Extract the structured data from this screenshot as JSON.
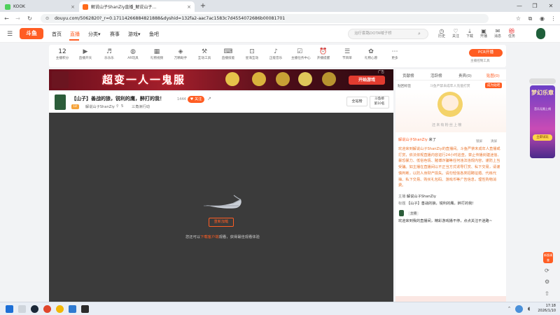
{
  "browser": {
    "tabs": [
      {
        "label": "KOOK",
        "close": "×"
      },
      {
        "label": "解说山子ShanZiy直播_解说山子…",
        "close": "×"
      }
    ],
    "new_tab": "+",
    "window_controls": [
      "—",
      "❐",
      "✕"
    ],
    "url": "douyu.com/5062820?_r=0.17114266884821888&dyshid=132fa2-aac7ac1583c7d4554072686b00081701"
  },
  "site": {
    "logo_text": "斗鱼",
    "nav": [
      "首页",
      "直播",
      "分类",
      "游戏",
      "赛事",
      "游戏",
      "鱼吧"
    ],
    "nav_final": [
      "首页",
      "直播",
      "分类▾",
      "赛事",
      "游戏▾",
      "鱼吧"
    ],
    "search_placeholder": "治疗套路DOTA喊子桥",
    "header_icons": [
      "历史",
      "关注",
      "下载",
      "开播",
      "消息",
      "任务"
    ]
  },
  "toolbar": {
    "score_value": "12",
    "score_label": "主播积分",
    "items": [
      "直播开天",
      "乐乐乐",
      "AR玩具",
      "礼物视频",
      "万精助手",
      "互动工具",
      "直播技能",
      "星海互动",
      "正能音乐",
      "主播任务中心",
      "开播提醒",
      "节目单",
      "礼物心愿",
      "更多"
    ],
    "pcr_button": "PCR开播",
    "subtitle": "主播控制工具"
  },
  "banner": {
    "title": "超变一人一鬼服",
    "cta": "开始游戏",
    "ad_tag": "广告"
  },
  "room": {
    "title": "【山子】善战的狼，锐利的鹰，醉打的我！",
    "level": "LV",
    "streamer": "解说山子ShanZiy",
    "room_num": "5",
    "category": "三角洲行动",
    "hot": "1444",
    "follow": "关注",
    "share_icon": "↗",
    "fullscreen_btn": "全站榜",
    "rank_btn": "斗鱼榜\n第10名"
  },
  "player": {
    "retry": "重新加载",
    "hint_pre": "您还可以",
    "hint_link": "下载客户端",
    "hint_post": "观看，获得最佳观看体验"
  },
  "panel": {
    "tabs": [
      "贡献榜",
      "活跃榜",
      "贵宾(0)",
      "贴图(0)"
    ],
    "sub_tabs": [
      "贴回标签",
      "斗鱼严禁未成年人充值打赏",
      "成为贴吧"
    ],
    "mascot_text": "还未有粉丝上榜",
    "chat": [
      {
        "name": "解说山子ShanZiy",
        "text": "来了"
      },
      {
        "name": "",
        "text": "欢迎来到解说山子ShanZiy的直播间。斗鱼严禁未成年人直播或打赏，依法依规直播内容进行24小时巡查。禁止传播封建迷信、暴恐暴力、低俗色情、赌博诈骗等任何违法违规内容，谨防上当受骗。如主播在直播间以不正当方式诱导打赏、私下交易，请谨慎判断，以防人身财产损失。请勿轻信各类招聘征婚、代练代抽、私下交易、购买礼包码、游戏币等广告信息，理性购物消费。"
      },
      {
        "name": "主播",
        "text": "解说山子ShanZiy"
      },
      {
        "name": "标题",
        "text": "【山子】善战的狼，锐利的鹰，醉打的我！"
      },
      {
        "name": "主播",
        "text": ""
      },
      {
        "name": "",
        "text": "欢迎来到我的直播间，精彩游戏播不停，点点关注不迷路~"
      }
    ],
    "chat_actions": [
      "锁屏",
      "清屏"
    ]
  },
  "side_ad": {
    "title": "梦幻乐章",
    "sub": "音乐无限上线",
    "cta": "立即试玩"
  },
  "side_tools": [
    "新版调查"
  ],
  "taskbar": {
    "time": "17:18",
    "date": "2026/1/10"
  },
  "colors": {
    "brand": "#ff5d23",
    "player_bg": "#3b3b3b",
    "retry_border": "#ff5d23"
  }
}
